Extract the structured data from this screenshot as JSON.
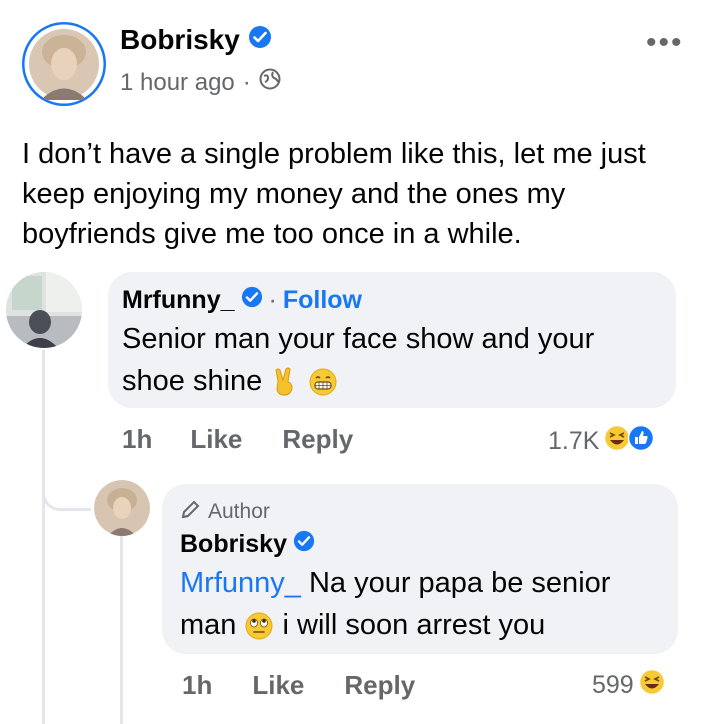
{
  "post": {
    "author": "Bobrisky",
    "time": "1 hour ago",
    "separator": "·",
    "more": "•••",
    "text": "I don’t have a single problem like this, let me just keep enjoying my money and the ones my boyfriends give me too once in a while."
  },
  "comment1": {
    "author": "Mrfunny_",
    "separator": "·",
    "follow": "Follow",
    "text": "Senior man your face show and your shoe shine",
    "time": "1h",
    "like": "Like",
    "reply": "Reply",
    "reactions": "1.7K"
  },
  "reply1": {
    "badge": "Author",
    "author": "Bobrisky",
    "mention": "Mrfunny_",
    "text_part1": " Na your papa be senior man",
    "text_part2": " i will soon arrest you",
    "time": "1h",
    "like": "Like",
    "reply": "Reply",
    "reactions": "599"
  },
  "colors": {
    "verified": "#1877f2",
    "link": "#1877f2",
    "bubble": "#f0f2f5",
    "muted": "#65676b"
  }
}
